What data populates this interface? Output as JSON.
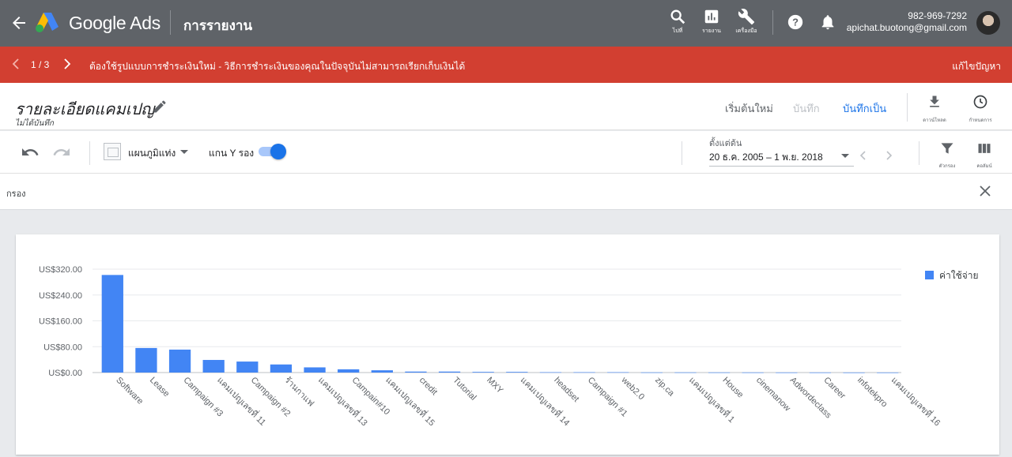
{
  "topbar": {
    "brand": "Google Ads",
    "section": "การรายงาน",
    "buttons": [
      {
        "label": "ไปที่",
        "icon": "search-icon"
      },
      {
        "label": "รายงาน",
        "icon": "reports-icon"
      },
      {
        "label": "เครื่องมือ",
        "icon": "wrench-icon"
      }
    ],
    "account_id": "982-969-7292",
    "account_email": "apichat.buotong@gmail.com"
  },
  "alert": {
    "counter": "1 / 3",
    "message": "ต้องใช้รูปแบบการชำระเงินใหม่ - วิธีการชำระเงินของคุณในปัจจุบันไม่สามารถเรียกเก็บเงินได้",
    "action": "แก้ไขปัญหา",
    "color": "#d23f31"
  },
  "header": {
    "title": "รายละเอียดแคมเปญ",
    "subtitle": "ไม่ได้บันทึก",
    "reset": "เริ่มต้นใหม่",
    "save": "บันทึก",
    "save_as": "บันทึกเป็น",
    "download": "ดาวน์โหลด",
    "schedule": "กำหนดการ"
  },
  "toolbar": {
    "chart_type": "แผนภูมิแท่ง",
    "secondary_axis": "แกน Y รอง",
    "secondary_axis_on": true,
    "date_caption": "ตั้งแต่ต้น",
    "date_range": "20 ธ.ค. 2005 – 1 พ.ย. 2018",
    "filter": "ตัวกรอง",
    "columns": "คอลัมน์"
  },
  "filterbar": {
    "label": "กรอง"
  },
  "chart_data": {
    "type": "bar",
    "categories": [
      "Software",
      "Lease",
      "Campaign #3",
      "แคมเปญเลขที่ 11",
      "Campaign #2",
      "ร้านกาแฟ",
      "แคมเปญเลขที่ 13",
      "Campain#10",
      "แคมเปญเลขที่ 15",
      "credit",
      "Tutorial",
      "MXY",
      "แคมเปญเลขที่ 14",
      "headset",
      "Campaign #1",
      "web2.0",
      "zip.ca",
      "แคมเปญเลขที่ 1",
      "House",
      "cinemanow",
      "Adwordeclass",
      "Career",
      "infotekpro",
      "แคมเปญเลขที่ 16"
    ],
    "series": [
      {
        "name": "ค่าใช้จ่าย",
        "color": "#4285f4",
        "values": [
          302,
          76,
          71,
          39,
          34,
          25,
          16,
          10,
          7,
          3,
          3,
          2,
          2,
          1,
          1,
          1,
          0.5,
          0.5,
          0.4,
          0.3,
          0.2,
          0.2,
          0.1,
          0.1
        ]
      }
    ],
    "yticks": [
      "US$0.00",
      "US$80.00",
      "US$160.00",
      "US$240.00",
      "US$320.00"
    ],
    "ylim": [
      0,
      320
    ],
    "grid": true,
    "legend": "top-right"
  }
}
